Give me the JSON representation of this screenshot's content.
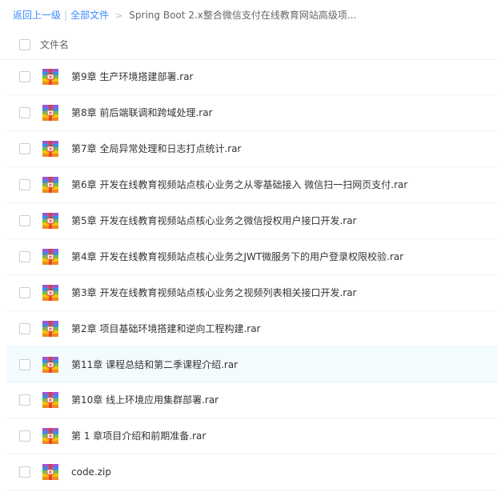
{
  "breadcrumb": {
    "back_label": "返回上一级",
    "separator": "|",
    "all_files_label": "全部文件",
    "arrow": ">",
    "current": "Spring Boot 2.x整合微信支付在线教育网站高级项..."
  },
  "header": {
    "column_name": "文件名"
  },
  "files": [
    {
      "name": "第9章 生产环境搭建部署.rar",
      "icon": "rar-archive-icon"
    },
    {
      "name": "第8章 前后端联调和跨域处理.rar",
      "icon": "rar-archive-icon"
    },
    {
      "name": "第7章 全局异常处理和日志打点统计.rar",
      "icon": "rar-archive-icon"
    },
    {
      "name": "第6章 开发在线教育视频站点核心业务之从零基础接入 微信扫一扫网页支付.rar",
      "icon": "rar-archive-icon"
    },
    {
      "name": "第5章 开发在线教育视频站点核心业务之微信授权用户接口开发.rar",
      "icon": "rar-archive-icon"
    },
    {
      "name": "第4章 开发在线教育视频站点核心业务之JWT微服务下的用户登录权限校验.rar",
      "icon": "rar-archive-icon"
    },
    {
      "name": "第3章 开发在线教育视频站点核心业务之视频列表相关接口开发.rar",
      "icon": "rar-archive-icon"
    },
    {
      "name": "第2章 项目基础环境搭建和逆向工程构建.rar",
      "icon": "rar-archive-icon"
    },
    {
      "name": "第11章 课程总结和第二季课程介绍.rar",
      "icon": "rar-archive-icon"
    },
    {
      "name": "第10章 线上环境应用集群部署.rar",
      "icon": "rar-archive-icon"
    },
    {
      "name": "第 1 章项目介绍和前期准备.rar",
      "icon": "rar-archive-icon"
    },
    {
      "name": "code.zip",
      "icon": "zip-archive-icon"
    }
  ],
  "colors": {
    "link": "#3b8cff",
    "hover_row": "#f4fbff",
    "icon_blue": "#3e8fe0",
    "icon_green": "#6cc24a",
    "icon_yellow": "#f5c400",
    "icon_orange": "#f08a24",
    "icon_red": "#e8504a",
    "icon_purple": "#9b59d0"
  },
  "hover_row_index": 8
}
